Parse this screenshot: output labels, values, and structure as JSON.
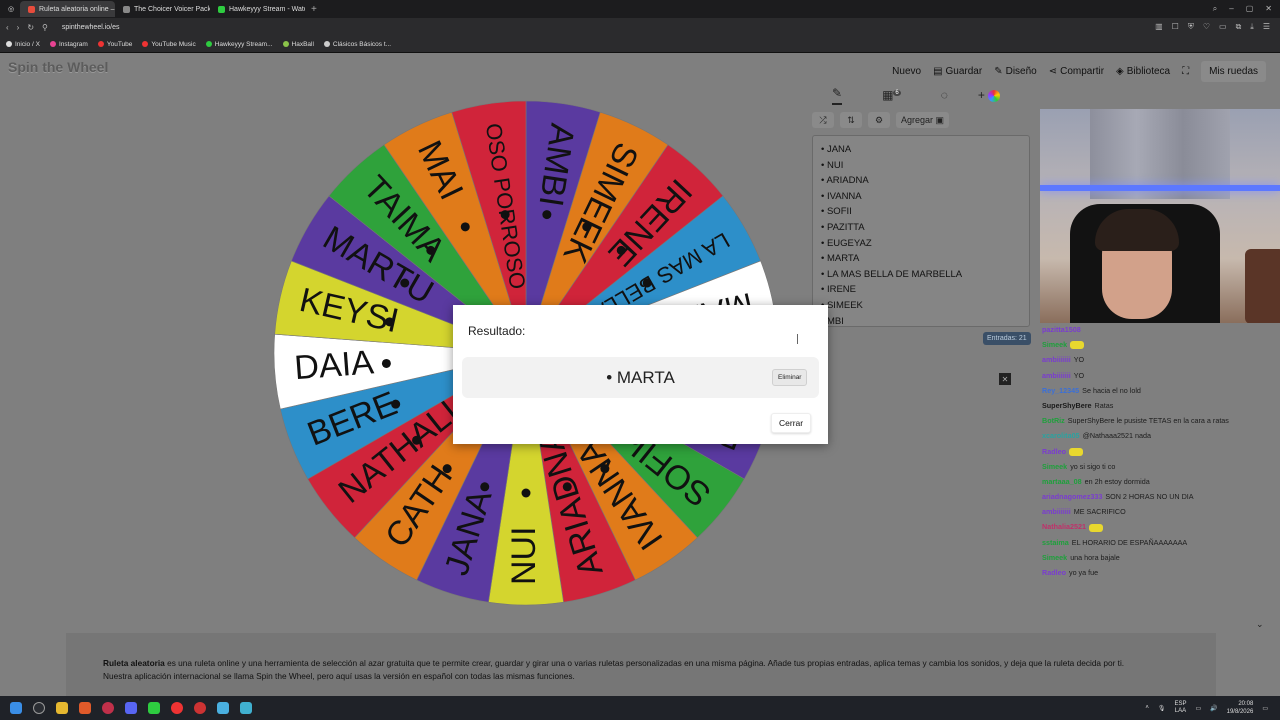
{
  "browser": {
    "tabs": [
      {
        "label": "Ruleta aleatoria online – ruleta...",
        "active": true,
        "color": "#e74c3c"
      },
      {
        "label": "The Choicer Voicer Packs...",
        "active": false,
        "color": "#888888"
      },
      {
        "label": "Hawkeyyy Stream - Watch...",
        "active": false,
        "color": "#2ecc40"
      }
    ],
    "url": "spinthewheel.io/es",
    "bookmarks": [
      "Inicio / X",
      "Instagram",
      "YouTube",
      "YouTube Music",
      "Hawkeyyy Stream...",
      "HaxBall",
      "Clásicos Básicos t..."
    ]
  },
  "site": {
    "logo": "Spin the Wheel",
    "nav": {
      "nuevo": "Nuevo",
      "guardar": "Guardar",
      "diseno": "Diseño",
      "compartir": "Compartir",
      "biblioteca": "Biblioteca",
      "mis_ruedas": "Mis ruedas"
    }
  },
  "wheel": {
    "segments": [
      {
        "label": "AMBI",
        "color": "#5a3aa0"
      },
      {
        "label": "SIMEEK",
        "color": "#e07b1a"
      },
      {
        "label": "IRENE",
        "color": "#d0243a"
      },
      {
        "label": "LA MAS BELLA DE...",
        "color": "#2d8fc9"
      },
      {
        "label": "MARTA",
        "color": "#ffffff"
      },
      {
        "label": "EUGEYAZ",
        "color": "#d4d52e"
      },
      {
        "label": "PAZITTA",
        "color": "#5a3aa0"
      },
      {
        "label": "SOFII",
        "color": "#2fa23b"
      },
      {
        "label": "IVANNA",
        "color": "#e07b1a"
      },
      {
        "label": "ARIADNA",
        "color": "#d0243a"
      },
      {
        "label": "NUI",
        "color": "#d4d52e"
      },
      {
        "label": "JANA",
        "color": "#5a3aa0"
      },
      {
        "label": "CATH",
        "color": "#e07b1a"
      },
      {
        "label": "NATHALIA",
        "color": "#d0243a"
      },
      {
        "label": "BERE",
        "color": "#2d8fc9"
      },
      {
        "label": "DAIA",
        "color": "#ffffff"
      },
      {
        "label": "KEYSI",
        "color": "#d4d52e"
      },
      {
        "label": "MARTU",
        "color": "#5a3aa0"
      },
      {
        "label": "TAIMA",
        "color": "#2fa23b"
      },
      {
        "label": "MAI",
        "color": "#e07b1a"
      },
      {
        "label": "OSO PORROSO",
        "color": "#d0243a"
      }
    ]
  },
  "panel": {
    "badge_count": "6",
    "add_label": "Agregar",
    "entries": [
      "JANA",
      "NUI",
      "ARIADNA",
      "IVANNA",
      "SOFII",
      "PAZITTA",
      "EUGEYAZ",
      "MARTA",
      "LA MAS BELLA DE MARBELLA",
      "IRENE",
      "SIMEEK",
      "MBI"
    ],
    "entries_count": "Entradas: 21"
  },
  "modal": {
    "title": "Resultado:",
    "result": "• MARTA",
    "eliminar": "Eliminar",
    "cerrar": "Cerrar"
  },
  "chat": [
    {
      "user": "pazitta1508",
      "text": "",
      "color": "#7a3ccf"
    },
    {
      "user": "Simeek",
      "text": "",
      "color": "#1fa03c",
      "emote": true
    },
    {
      "user": "ambiiiiiii",
      "text": "YO",
      "color": "#7a3ccf"
    },
    {
      "user": "ambiiiiiii",
      "text": "YO",
      "color": "#7a3ccf"
    },
    {
      "user": "Rey_12345",
      "text": "Se hacia el no lold",
      "color": "#3a6fd8"
    },
    {
      "user": "SuperShyBere",
      "text": "Ratas",
      "color": "#1a1a1a"
    },
    {
      "user": "BotRiz",
      "text": "SuperShyBere le pusiste TETAS en la cara a ratas",
      "color": "#1fa03c"
    },
    {
      "user": "xcarolita05",
      "text": "@Nathaaa2521 nada",
      "color": "#2aa3a0"
    },
    {
      "user": "Radleo",
      "text": "",
      "color": "#7a3ccf",
      "emote": true
    },
    {
      "user": "Simeek",
      "text": "yo si sigo ti co",
      "color": "#1fa03c"
    },
    {
      "user": "martaaa_08",
      "text": "en 2h estoy dormida",
      "color": "#1fa03c"
    },
    {
      "user": "ariadnagomez333",
      "text": "SON 2 HORAS NO UN DIA",
      "color": "#7a3ccf"
    },
    {
      "user": "ambiiiiiii",
      "text": "ME SACRIFICO",
      "color": "#7a3ccf"
    },
    {
      "user": "Nathalia2521",
      "text": "",
      "color": "#c0306a",
      "emote": true
    },
    {
      "user": "sstaima",
      "text": "EL HORARIO DE ESPAÑAAAAAAA",
      "color": "#1fa03c"
    },
    {
      "user": "Simeek",
      "text": "una hora bajale",
      "color": "#1fa03c"
    },
    {
      "user": "Radleo",
      "text": "yo ya fue",
      "color": "#7a3ccf"
    }
  ],
  "info": {
    "bold": "Ruleta aleatoria",
    "text1": " es una ruleta online y una herramienta de selección al azar gratuita que te permite crear, guardar y girar una o varias ruletas personalizadas en una misma página. Añade tus propias entradas, aplica temas y cambia los sonidos, y deja que la ruleta decida por ti.",
    "text2": "Nuestra aplicación internacional se llama Spin the Wheel, pero aquí usas la versión en español con todas las mismas funciones."
  },
  "taskbar": {
    "lang": "ESP",
    "lang2": "LAA",
    "time": "20:08",
    "date": "19/8/2026"
  }
}
